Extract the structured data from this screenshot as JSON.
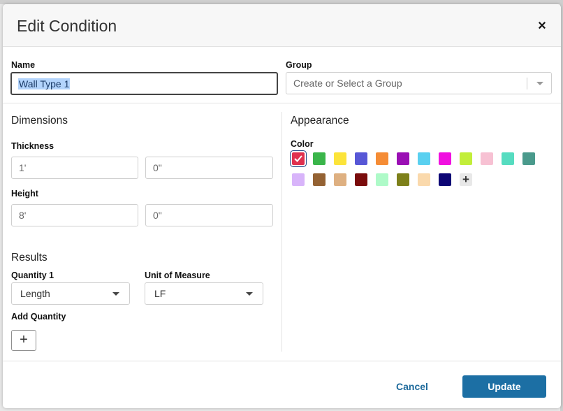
{
  "dialog": {
    "title": "Edit Condition",
    "close_label": "×"
  },
  "name_field": {
    "label": "Name",
    "value": "Wall Type 1"
  },
  "group_field": {
    "label": "Group",
    "placeholder": "Create or Select a Group"
  },
  "dimensions": {
    "title": "Dimensions",
    "thickness": {
      "label": "Thickness",
      "feet": "1'",
      "inches": "0\""
    },
    "height": {
      "label": "Height",
      "feet": "8'",
      "inches": "0\""
    }
  },
  "results": {
    "title": "Results",
    "quantity_label": "Quantity 1",
    "quantity_value": "Length",
    "unit_label": "Unit of Measure",
    "unit_value": "LF",
    "add_quantity_label": "Add Quantity",
    "add_quantity_button": "+"
  },
  "appearance": {
    "title": "Appearance",
    "color_label": "Color",
    "selected_color": "#e0314f",
    "add_color_label": "+",
    "colors_row1": [
      "#e0314f",
      "#3ab54a",
      "#fce43a",
      "#5757d6",
      "#f58c35",
      "#9a0fb4",
      "#5ad0f0",
      "#f010e0",
      "#c2ee3a",
      "#f7c1d3",
      "#56dcc0",
      "#4a9a8c"
    ],
    "colors_row2": [
      "#d8b4fa",
      "#946233",
      "#deb081",
      "#7a0c0c",
      "#aefac8",
      "#7d801a",
      "#fad9ac",
      "#0d0575"
    ]
  },
  "footer": {
    "cancel_label": "Cancel",
    "update_label": "Update"
  }
}
